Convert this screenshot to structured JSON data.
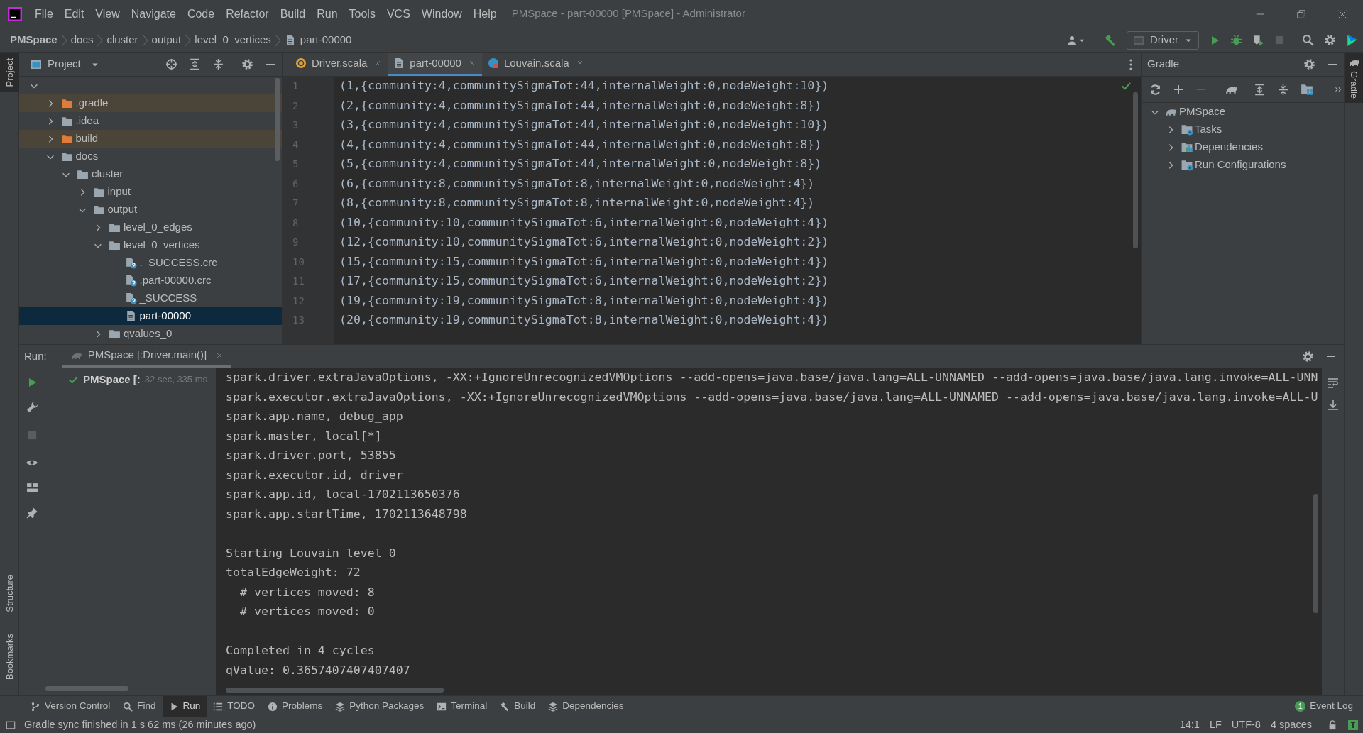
{
  "window": {
    "title": "PMSpace - part-00000 [PMSpace] - Administrator"
  },
  "menu": [
    "File",
    "Edit",
    "View",
    "Navigate",
    "Code",
    "Refactor",
    "Build",
    "Run",
    "Tools",
    "VCS",
    "Window",
    "Help"
  ],
  "breadcrumbs": [
    {
      "label": "PMSpace",
      "kind": "project"
    },
    {
      "label": "docs",
      "kind": "folder"
    },
    {
      "label": "cluster",
      "kind": "folder"
    },
    {
      "label": "output",
      "kind": "folder"
    },
    {
      "label": "level_0_vertices",
      "kind": "folder"
    },
    {
      "label": "part-00000",
      "kind": "file"
    }
  ],
  "run_config": {
    "label": "Driver"
  },
  "left_stripe": {
    "top": [
      {
        "label": "Project",
        "selected": true
      }
    ],
    "bottom": [
      {
        "label": "Structure",
        "selected": false
      },
      {
        "label": "Bookmarks",
        "selected": false
      }
    ]
  },
  "project_panel": {
    "title": "Project",
    "tree": {
      "expanded": true,
      "selected": false,
      "children": [
        {
          "label": ".gradle",
          "kind": "folder",
          "expanded": false,
          "excluded": true,
          "selected": false
        },
        {
          "label": ".idea",
          "kind": "folder",
          "expanded": false,
          "excluded": false,
          "selected": false
        },
        {
          "label": "build",
          "kind": "folder",
          "expanded": false,
          "excluded": true,
          "selected": false
        },
        {
          "label": "docs",
          "kind": "folder",
          "expanded": true,
          "excluded": false,
          "selected": false,
          "children": [
            {
              "label": "cluster",
              "kind": "folder",
              "expanded": true,
              "excluded": false,
              "selected": false,
              "children": [
                {
                  "label": "input",
                  "kind": "folder",
                  "expanded": false,
                  "excluded": false,
                  "selected": false
                },
                {
                  "label": "output",
                  "kind": "folder",
                  "expanded": true,
                  "excluded": false,
                  "selected": false,
                  "children": [
                    {
                      "label": "level_0_edges",
                      "kind": "folder",
                      "expanded": false,
                      "excluded": false,
                      "selected": false
                    },
                    {
                      "label": "level_0_vertices",
                      "kind": "folder",
                      "expanded": true,
                      "excluded": false,
                      "selected": false,
                      "children": [
                        {
                          "label": "._SUCCESS.crc",
                          "kind": "unknown_file",
                          "excluded": false,
                          "selected": false
                        },
                        {
                          "label": ".part-00000.crc",
                          "kind": "unknown_file",
                          "excluded": false,
                          "selected": false
                        },
                        {
                          "label": "_SUCCESS",
                          "kind": "unknown_file",
                          "excluded": false,
                          "selected": false
                        },
                        {
                          "label": "part-00000",
                          "kind": "text_file",
                          "excluded": false,
                          "selected": true
                        }
                      ]
                    },
                    {
                      "label": "qvalues_0",
                      "kind": "folder",
                      "expanded": false,
                      "excluded": false,
                      "selected": false
                    }
                  ]
                }
              ]
            }
          ]
        }
      ]
    }
  },
  "editor_tabs": [
    {
      "label": "Driver.scala",
      "kind": "scala_object",
      "selected": false
    },
    {
      "label": "part-00000",
      "kind": "text_file",
      "selected": true
    },
    {
      "label": "Louvain.scala",
      "kind": "scala_class",
      "selected": false
    }
  ],
  "editor_lines": [
    {
      "number": "1",
      "text": "(1,{community:4,communitySigmaTot:44,internalWeight:0,nodeWeight:10})"
    },
    {
      "number": "2",
      "text": "(2,{community:4,communitySigmaTot:44,internalWeight:0,nodeWeight:8})"
    },
    {
      "number": "3",
      "text": "(3,{community:4,communitySigmaTot:44,internalWeight:0,nodeWeight:10})"
    },
    {
      "number": "4",
      "text": "(4,{community:4,communitySigmaTot:44,internalWeight:0,nodeWeight:8})"
    },
    {
      "number": "5",
      "text": "(5,{community:4,communitySigmaTot:44,internalWeight:0,nodeWeight:8})"
    },
    {
      "number": "6",
      "text": "(6,{community:8,communitySigmaTot:8,internalWeight:0,nodeWeight:4})"
    },
    {
      "number": "7",
      "text": "(8,{community:8,communitySigmaTot:8,internalWeight:0,nodeWeight:4})"
    },
    {
      "number": "8",
      "text": "(10,{community:10,communitySigmaTot:6,internalWeight:0,nodeWeight:4})"
    },
    {
      "number": "9",
      "text": "(12,{community:10,communitySigmaTot:6,internalWeight:0,nodeWeight:2})"
    },
    {
      "number": "10",
      "text": "(15,{community:15,communitySigmaTot:6,internalWeight:0,nodeWeight:4})"
    },
    {
      "number": "11",
      "text": "(17,{community:15,communitySigmaTot:6,internalWeight:0,nodeWeight:2})"
    },
    {
      "number": "12",
      "text": "(19,{community:19,communitySigmaTot:8,internalWeight:0,nodeWeight:4})"
    },
    {
      "number": "13",
      "text": "(20,{community:19,communitySigmaTot:8,internalWeight:0,nodeWeight:4})"
    }
  ],
  "gradle_panel": {
    "title": "Gradle",
    "tree": [
      {
        "label": "PMSpace",
        "kind": "project",
        "expanded": true,
        "children": [
          {
            "label": "Tasks",
            "kind": "tasks",
            "expanded": false
          },
          {
            "label": "Dependencies",
            "kind": "dependencies",
            "expanded": false
          },
          {
            "label": "Run Configurations",
            "kind": "run_configurations",
            "expanded": false
          }
        ]
      }
    ]
  },
  "right_stripe": [
    {
      "label": "Gradle",
      "selected": true
    }
  ],
  "run_panel": {
    "label": "Run:",
    "tab": "PMSpace [:Driver.main()]",
    "tree": [
      {
        "label": "PMSpace [:",
        "duration": "32 sec, 335 ms",
        "kind": "passed"
      }
    ],
    "console": [
      [
        "spark.driver.extraJavaOptions, -XX:+IgnoreUnrecognizedVMOptions --add-opens=java.base/java.lang=ALL-UNNAMED --add-opens=java.base/java.lang.invoke=ALL-UNN",
        "spark.executor.extraJavaOptions, -XX:+IgnoreUnrecognizedVMOptions --add-opens=java.base/java.lang=ALL-UNNAMED --add-opens=java.base/java.lang.invoke=ALL-U",
        "spark.app.name, debug_app",
        "spark.master, local[*]",
        "spark.driver.port, 53855",
        "spark.executor.id, driver",
        "spark.app.id, local-1702113650376",
        "spark.app.startTime, 1702113648798"
      ],
      [
        "Starting Louvain level 0",
        "totalEdgeWeight: 72",
        "  # vertices moved: 8",
        "  # vertices moved: 0"
      ],
      [
        "Completed in 4 cycles",
        "qValue: 0.3657407407407407"
      ]
    ]
  },
  "tool_tabs": [
    {
      "label": "Version Control",
      "kind": "vcs",
      "selected": false
    },
    {
      "label": "Find",
      "kind": "find",
      "selected": false
    },
    {
      "label": "Run",
      "kind": "run",
      "selected": true
    },
    {
      "label": "TODO",
      "kind": "todo",
      "selected": false
    },
    {
      "label": "Problems",
      "kind": "problems",
      "selected": false
    },
    {
      "label": "Python Packages",
      "kind": "packages",
      "selected": false
    },
    {
      "label": "Terminal",
      "kind": "terminal",
      "selected": false
    },
    {
      "label": "Build",
      "kind": "build",
      "selected": false
    },
    {
      "label": "Dependencies",
      "kind": "packages",
      "selected": false
    }
  ],
  "event_log": {
    "label": "Event Log",
    "count": "1"
  },
  "status_bar": {
    "message": "Gradle sync finished in 1 s 62 ms (26 minutes ago)",
    "position": "14:1",
    "line_separator": "LF",
    "encoding": "UTF-8",
    "indent": "4 spaces"
  }
}
